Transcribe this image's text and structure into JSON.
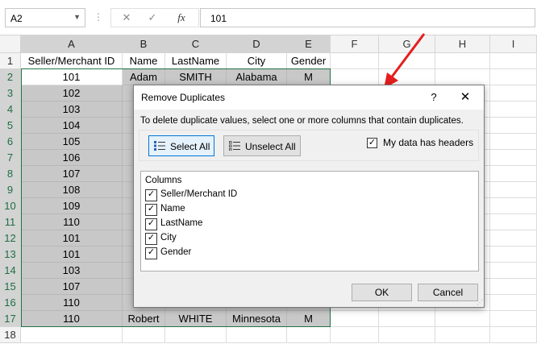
{
  "formula_bar": {
    "name_box": "A2",
    "cancel_icon": "✕",
    "enter_icon": "✓",
    "fx_label": "fx",
    "formula_value": "101"
  },
  "sheet": {
    "columns": [
      "A",
      "B",
      "C",
      "D",
      "E",
      "F",
      "G",
      "H",
      "I"
    ],
    "rows": [
      "1",
      "2",
      "3",
      "4",
      "5",
      "6",
      "7",
      "8",
      "9",
      "10",
      "11",
      "12",
      "13",
      "14",
      "15",
      "16",
      "17",
      "18"
    ],
    "header_row": [
      "Seller/Merchant ID",
      "Name",
      "LastName",
      "City",
      "Gender"
    ],
    "row2": [
      "101",
      "Adam",
      "SMITH",
      "Alabama",
      "M"
    ],
    "ids": [
      "102",
      "103",
      "104",
      "105",
      "106",
      "107",
      "108",
      "109",
      "110",
      "101",
      "101",
      "103",
      "107",
      "110"
    ],
    "partial_names": [
      "",
      "",
      "",
      "",
      "",
      "S",
      "M",
      "",
      "R",
      "A",
      "A",
      "",
      "S",
      "R"
    ],
    "row17": [
      "110",
      "Robert",
      "WHITE",
      "Minnesota",
      "M"
    ]
  },
  "dialog": {
    "title": "Remove Duplicates",
    "help": "?",
    "close": "✕",
    "instruction": "To delete duplicate values, select one or more columns that contain duplicates.",
    "select_all_label": "Select All",
    "unselect_all_label": "Unselect All",
    "headers_label": "My data has headers",
    "headers_checked": true,
    "columns_title": "Columns",
    "column_items": [
      {
        "label": "Seller/Merchant ID",
        "checked": true
      },
      {
        "label": "Name",
        "checked": true
      },
      {
        "label": "LastName",
        "checked": true
      },
      {
        "label": "City",
        "checked": true
      },
      {
        "label": "Gender",
        "checked": true
      }
    ],
    "ok_label": "OK",
    "cancel_label": "Cancel"
  },
  "colors": {
    "selection_border": "#217346",
    "selected_fill": "#c8c8c8",
    "arrow": "#e41e1e",
    "focus_button": "#0078d7"
  }
}
